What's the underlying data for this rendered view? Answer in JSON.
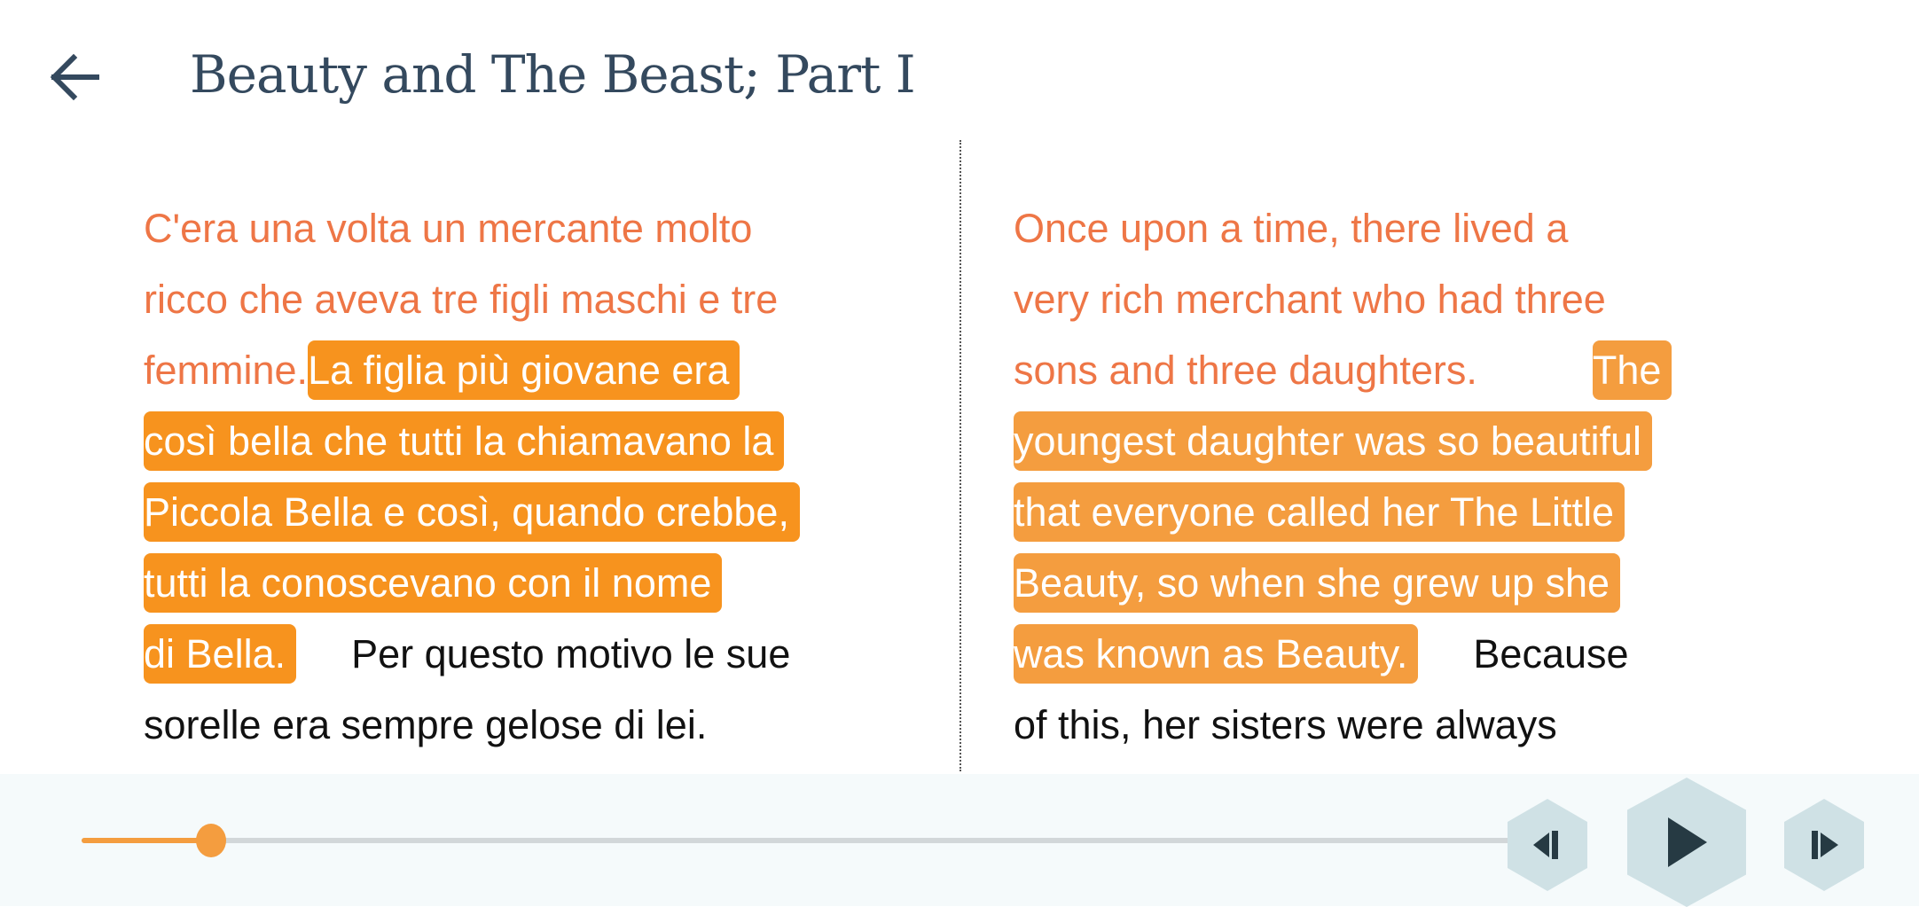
{
  "header": {
    "back_icon": "arrow-left-icon",
    "title": "Beauty and The Beast; Part I"
  },
  "colors": {
    "read_text": "#ee7646",
    "highlight_left": "#f7931e",
    "highlight_right": "#f49d3f",
    "title": "#34495e",
    "player_button": "#cfe1e5"
  },
  "italian": {
    "lines": [
      {
        "read": "C'era una volta un mercante molto"
      },
      {
        "read": "ricco che aveva tre figli maschi e tre"
      },
      {
        "read": "femmine.",
        "current": "La figlia più giovane era"
      },
      {
        "current": "così bella che tutti la chiamavano la"
      },
      {
        "current": "Piccola Bella e così, quando crebbe,"
      },
      {
        "current": "tutti la conoscevano con il nome"
      },
      {
        "current": "di Bella.",
        "unread": "Per questo motivo le sue"
      },
      {
        "unread": "sorelle era sempre gelose di lei."
      }
    ]
  },
  "english": {
    "lines": [
      {
        "read": "Once upon a time, there lived a"
      },
      {
        "read": "very rich merchant who had three"
      },
      {
        "read": "sons and three daughters.",
        "current": "The"
      },
      {
        "current": "youngest daughter was so beautiful"
      },
      {
        "current": "that everyone called her The Little"
      },
      {
        "current": "Beauty, so when she grew up she"
      },
      {
        "current": "was known as Beauty.",
        "unread": "Because"
      },
      {
        "unread": "of this, her sisters were always"
      }
    ]
  },
  "player": {
    "progress_percent": 9,
    "prev_icon": "skip-previous-icon",
    "play_icon": "play-icon",
    "next_icon": "skip-next-icon"
  }
}
